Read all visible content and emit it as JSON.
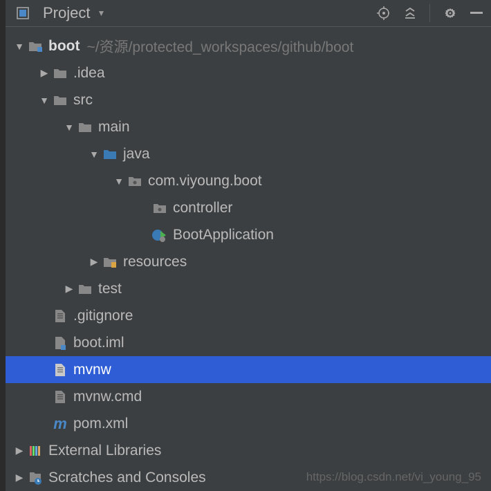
{
  "toolbar": {
    "title": "Project"
  },
  "tree": {
    "root_name": "boot",
    "root_path": "~/资源/protected_workspaces/github/boot",
    "idea": ".idea",
    "src": "src",
    "main": "main",
    "java": "java",
    "pkg": "com.viyoung.boot",
    "controller": "controller",
    "bootapp": "BootApplication",
    "resources": "resources",
    "test": "test",
    "gitignore": ".gitignore",
    "bootiml": "boot.iml",
    "mvnw": "mvnw",
    "mvnwcmd": "mvnw.cmd",
    "pom": "pom.xml",
    "extlib": "External Libraries",
    "scratches": "Scratches and Consoles"
  },
  "watermark": "https://blog.csdn.net/vi_young_95"
}
